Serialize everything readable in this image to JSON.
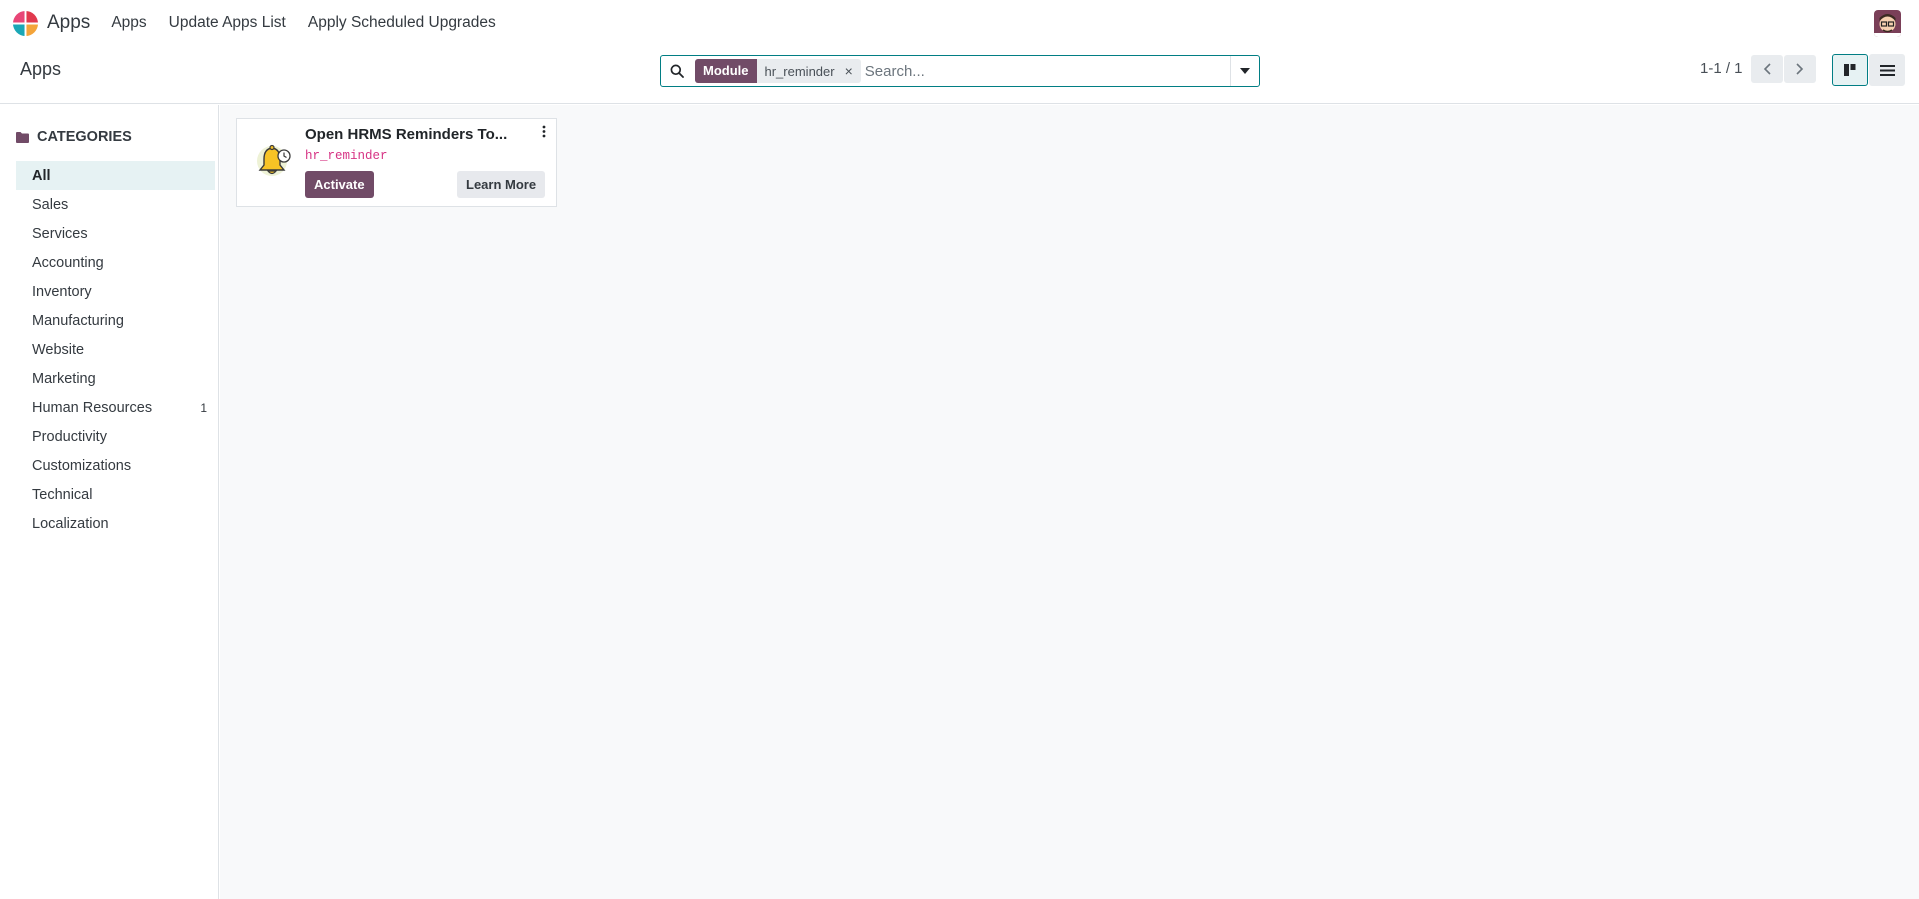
{
  "navbar": {
    "app_name": "Apps",
    "menu": [
      "Apps",
      "Update Apps List",
      "Apply Scheduled Upgrades"
    ]
  },
  "control_panel": {
    "breadcrumb": "Apps",
    "search": {
      "facet_label": "Module",
      "facet_value": "hr_reminder",
      "facet_remove": "×",
      "placeholder": "Search..."
    },
    "pager": "1-1 / 1"
  },
  "sidebar": {
    "header": "CATEGORIES",
    "items": [
      {
        "label": "All",
        "count": ""
      },
      {
        "label": "Sales",
        "count": ""
      },
      {
        "label": "Services",
        "count": ""
      },
      {
        "label": "Accounting",
        "count": ""
      },
      {
        "label": "Inventory",
        "count": ""
      },
      {
        "label": "Manufacturing",
        "count": ""
      },
      {
        "label": "Website",
        "count": ""
      },
      {
        "label": "Marketing",
        "count": ""
      },
      {
        "label": "Human Resources",
        "count": "1"
      },
      {
        "label": "Productivity",
        "count": ""
      },
      {
        "label": "Customizations",
        "count": ""
      },
      {
        "label": "Technical",
        "count": ""
      },
      {
        "label": "Localization",
        "count": ""
      }
    ]
  },
  "apps": [
    {
      "title": "Open HRMS Reminders To...",
      "technical_name": "hr_reminder",
      "activate_label": "Activate",
      "learn_more_label": "Learn More",
      "icon": "bell-clock-icon"
    }
  ],
  "colors": {
    "brand": "#714b67",
    "accent": "#017e84",
    "technical_name": "#d63384"
  }
}
